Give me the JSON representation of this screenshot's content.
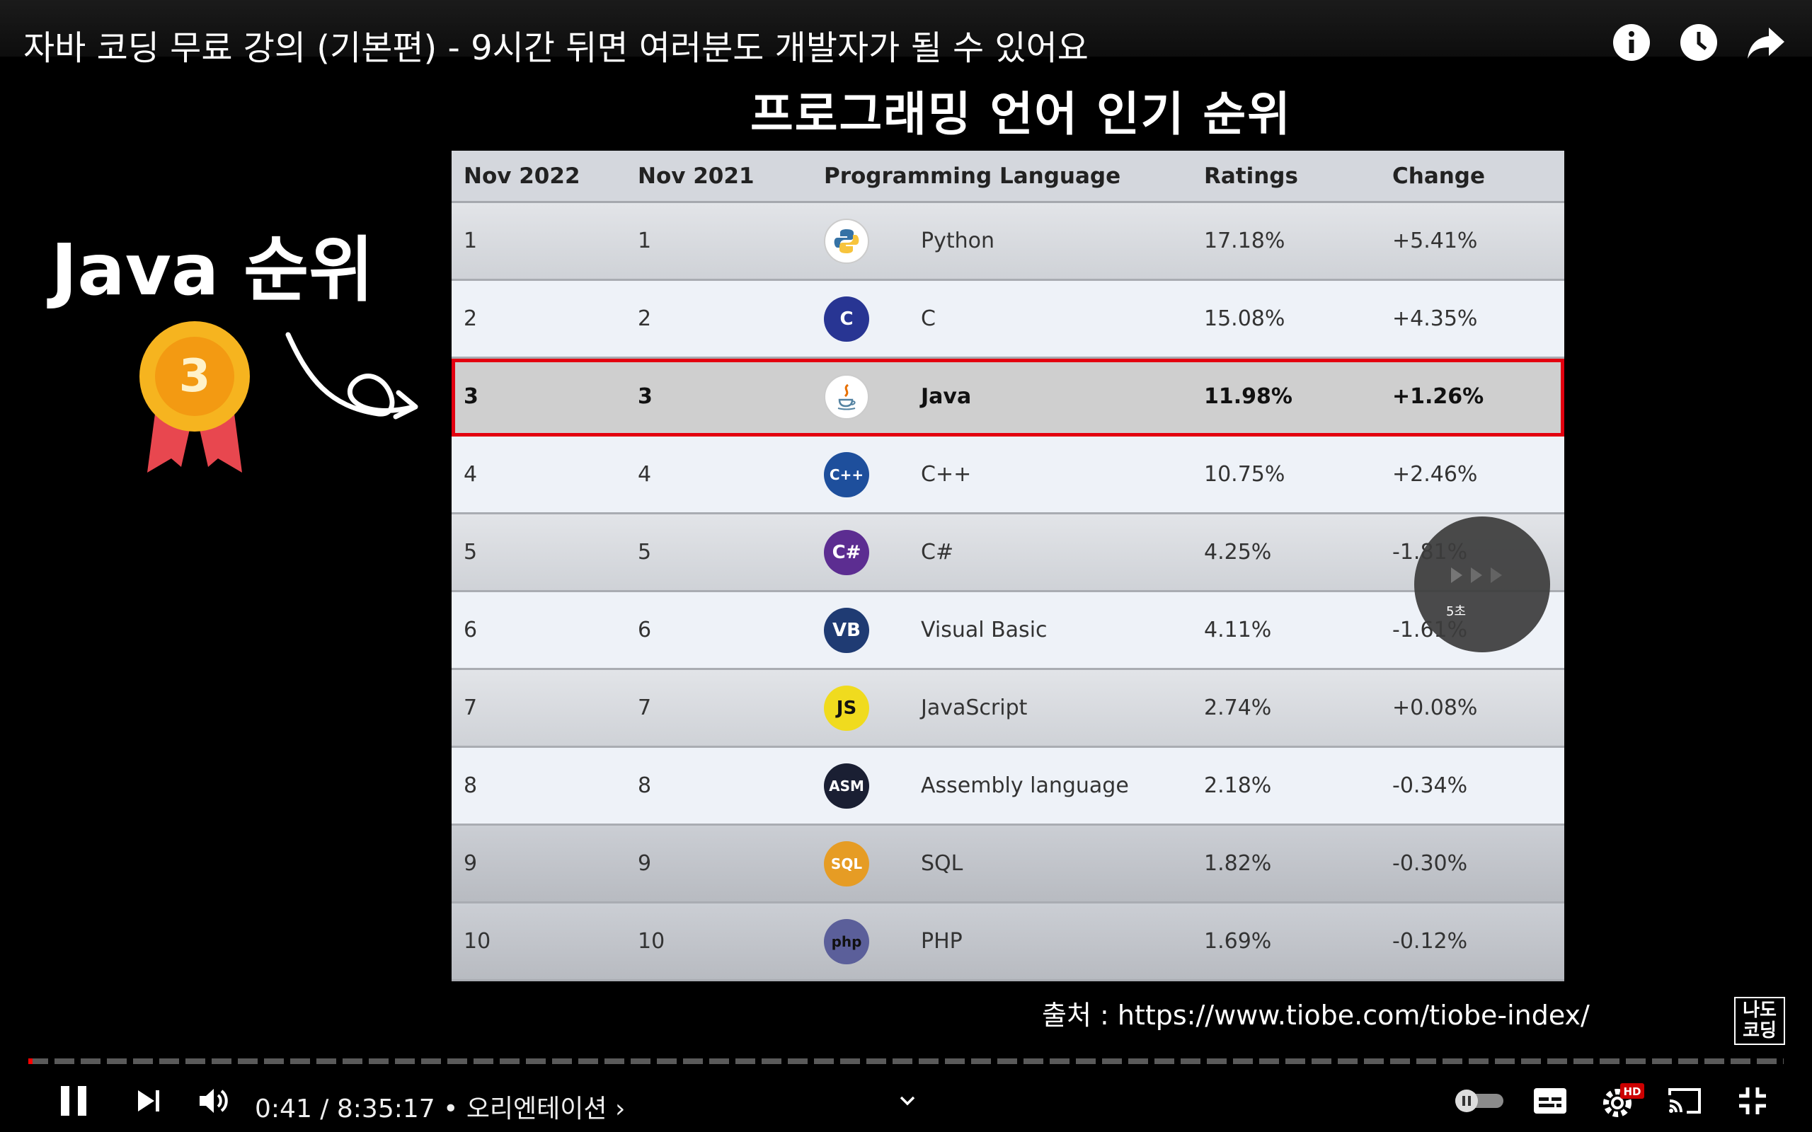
{
  "video": {
    "title": "자바 코딩 무료 강의 (기본편) - 9시간 뒤면 여러분도 개발자가 될 수 있어요",
    "time_current": "0:41",
    "time_separator": "/",
    "time_total": "8:35:17",
    "chapter_separator": "•",
    "chapter": "오리엔테이션",
    "chapter_arrow": "›",
    "progress": 0.0013,
    "hd_badge": "HD"
  },
  "top_icons": [
    "info-icon",
    "watch-later-icon",
    "share-icon"
  ],
  "slide": {
    "heading": "프로그래밍 언어 인기 순위",
    "side_title": "Java 순위",
    "medal_number": "3",
    "source": "출처 : https://www.tiobe.com/tiobe-index/",
    "watermark_line1": "나도",
    "watermark_line2": "코딩",
    "skip_label": "5초",
    "table": {
      "headers": [
        "Nov 2022",
        "Nov 2021",
        "Programming Language",
        "Ratings",
        "Change"
      ],
      "rows": [
        {
          "r2022": "1",
          "r2021": "1",
          "language": "Python",
          "rating": "17.18%",
          "change": "+5.41%",
          "logo": "python-logo",
          "logo_text": "",
          "logo_bg": "#ffffff",
          "logo_fg": "#3572a5"
        },
        {
          "r2022": "2",
          "r2021": "2",
          "language": "C",
          "rating": "15.08%",
          "change": "+4.35%",
          "logo": "c-logo",
          "logo_text": "C",
          "logo_bg": "#283593",
          "logo_fg": "#ffffff"
        },
        {
          "r2022": "3",
          "r2021": "3",
          "language": "Java",
          "rating": "11.98%",
          "change": "+1.26%",
          "logo": "java-logo",
          "logo_text": "",
          "logo_bg": "#ffffff",
          "logo_fg": "#e76f00"
        },
        {
          "r2022": "4",
          "r2021": "4",
          "language": "C++",
          "rating": "10.75%",
          "change": "+2.46%",
          "logo": "cpp-logo",
          "logo_text": "C++",
          "logo_bg": "#1e4f9c",
          "logo_fg": "#ffffff"
        },
        {
          "r2022": "5",
          "r2021": "5",
          "language": "C#",
          "rating": "4.25%",
          "change": "-1.81%",
          "logo": "csharp-logo",
          "logo_text": "C#",
          "logo_bg": "#5c2d91",
          "logo_fg": "#ffffff"
        },
        {
          "r2022": "6",
          "r2021": "6",
          "language": "Visual Basic",
          "rating": "4.11%",
          "change": "-1.61%",
          "logo": "vb-logo",
          "logo_text": "VB",
          "logo_bg": "#1f3b73",
          "logo_fg": "#ffffff"
        },
        {
          "r2022": "7",
          "r2021": "7",
          "language": "JavaScript",
          "rating": "2.74%",
          "change": "+0.08%",
          "logo": "js-logo",
          "logo_text": "JS",
          "logo_bg": "#f0db1e",
          "logo_fg": "#111111"
        },
        {
          "r2022": "8",
          "r2021": "8",
          "language": "Assembly language",
          "rating": "2.18%",
          "change": "-0.34%",
          "logo": "asm-logo",
          "logo_text": "ASM",
          "logo_bg": "#1a1f33",
          "logo_fg": "#ffffff"
        },
        {
          "r2022": "9",
          "r2021": "9",
          "language": "SQL",
          "rating": "1.82%",
          "change": "-0.30%",
          "logo": "sql-logo",
          "logo_text": "SQL",
          "logo_bg": "#e69c24",
          "logo_fg": "#ffffff"
        },
        {
          "r2022": "10",
          "r2021": "10",
          "language": "PHP",
          "rating": "1.69%",
          "change": "-0.12%",
          "logo": "php-logo",
          "logo_text": "php",
          "logo_bg": "#5b5f9a",
          "logo_fg": "#111111"
        }
      ]
    }
  },
  "controls": [
    "pause-icon",
    "next-icon",
    "volume-icon",
    "chevron-down-icon",
    "autoplay-toggle",
    "subtitles-icon",
    "settings-icon",
    "cast-icon",
    "exit-fullscreen-icon"
  ],
  "colors": {
    "progress_played": "#ff0000",
    "highlight_border": "#e3000f",
    "hd_badge": "#cc0000"
  }
}
